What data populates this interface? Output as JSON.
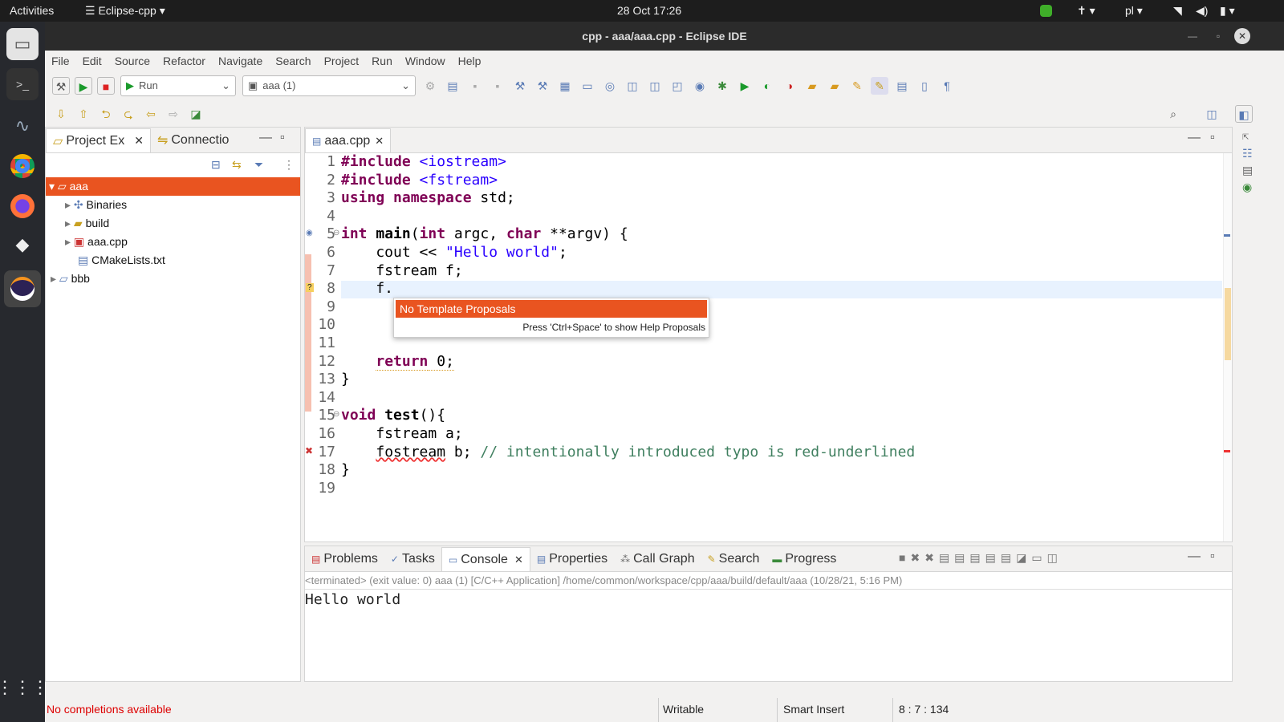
{
  "topbar": {
    "activities": "Activities",
    "app": "Eclipse-cpp ▾",
    "clock": "28 Oct  17:26",
    "lang": "pl ▾"
  },
  "window": {
    "title": "cpp - aaa/aaa.cpp - Eclipse IDE"
  },
  "menu": [
    "File",
    "Edit",
    "Source",
    "Refactor",
    "Navigate",
    "Search",
    "Project",
    "Run",
    "Window",
    "Help"
  ],
  "toolbar": {
    "launch_mode": "Run",
    "launch_config": "aaa (1)"
  },
  "project_explorer": {
    "tabs": [
      "Project Ex",
      "Connectio"
    ],
    "tree": [
      {
        "label": "aaa",
        "level": 0,
        "expanded": true,
        "selected": true
      },
      {
        "label": "Binaries",
        "level": 1
      },
      {
        "label": "build",
        "level": 1
      },
      {
        "label": "aaa.cpp",
        "level": 1
      },
      {
        "label": "CMakeLists.txt",
        "level": 1
      },
      {
        "label": "bbb",
        "level": 0
      }
    ]
  },
  "editor": {
    "tab": "aaa.cpp",
    "line_numbers": [
      "1",
      "2",
      "3",
      "4",
      "5",
      "6",
      "7",
      "8",
      "9",
      "10",
      "11",
      "12",
      "13",
      "14",
      "15",
      "16",
      "17",
      "18",
      "19"
    ],
    "code": {
      "l1a": "#include",
      "l1b": " <iostream>",
      "l2a": "#include",
      "l2b": " <fstream>",
      "l3a": "using namespace",
      "l3b": " std;",
      "l5a": "int",
      "l5b": " ",
      "l5c": "main",
      "l5d": "(",
      "l5e": "int",
      "l5f": " argc, ",
      "l5g": "char",
      "l5h": " **argv) {",
      "l6a": "    cout << ",
      "l6b": "\"Hello world\"",
      "l6c": ";",
      "l7": "    fstream f;",
      "l8": "    f.",
      "l12a": "    ",
      "l12b": "return",
      "l12c": " 0;",
      "l13": "}",
      "l15a": "void",
      "l15b": " ",
      "l15c": "test",
      "l15d": "(){",
      "l16": "    fstream a;",
      "l17a": "    ",
      "l17b": "fostream",
      "l17c": " b; ",
      "l17d": "// intentionally introduced typo is red-underlined",
      "l18": "}"
    },
    "popup": {
      "proposal": "No Template Proposals",
      "hint": "Press 'Ctrl+Space' to show Help Proposals"
    }
  },
  "bottom": {
    "tabs": [
      "Problems",
      "Tasks",
      "Console",
      "Properties",
      "Call Graph",
      "Search",
      "Progress"
    ],
    "active_tab": "Console",
    "console_header": "<terminated> (exit value: 0) aaa (1) [C/C++ Application] /home/common/workspace/cpp/aaa/build/default/aaa (10/28/21, 5:16 PM)",
    "console_output": "Hello world"
  },
  "status": {
    "message": "No completions available",
    "writable": "Writable",
    "insert_mode": "Smart Insert",
    "position": "8 : 7 : 134"
  },
  "colors": {
    "accent": "#e95420",
    "titlebar": "#2b2b2b"
  }
}
